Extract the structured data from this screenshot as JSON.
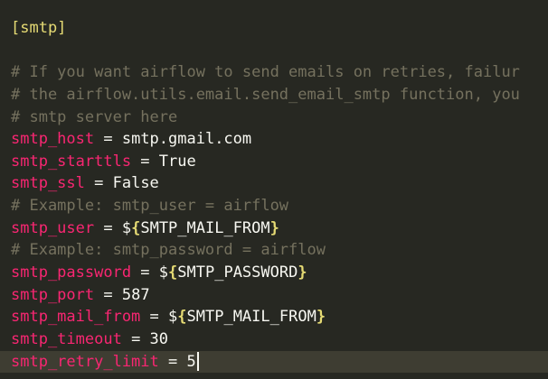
{
  "section_header": "[smtp]",
  "comments": {
    "c1": "# If you want airflow to send emails on retries, failur",
    "c2": "# the airflow.utils.email.send_email_smtp function, you",
    "c3": "# smtp server here",
    "c4": "# Example: smtp_user = airflow",
    "c5": "# Example: smtp_password = airflow"
  },
  "operator": " = ",
  "entries": {
    "smtp_host": {
      "key": "smtp_host",
      "value": "smtp.gmail.com"
    },
    "smtp_starttls": {
      "key": "smtp_starttls",
      "value": "True"
    },
    "smtp_ssl": {
      "key": "smtp_ssl",
      "value": "False"
    },
    "smtp_user": {
      "key": "smtp_user",
      "prefix": "$",
      "open": "{",
      "var": "SMTP_MAIL_FROM",
      "close": "}"
    },
    "smtp_password": {
      "key": "smtp_password",
      "prefix": "$",
      "open": "{",
      "var": "SMTP_PASSWORD",
      "close": "}"
    },
    "smtp_port": {
      "key": "smtp_port",
      "value": "587"
    },
    "smtp_mail_from": {
      "key": "smtp_mail_from",
      "prefix": "$",
      "open": "{",
      "var": "SMTP_MAIL_FROM",
      "close": "}"
    },
    "smtp_timeout": {
      "key": "smtp_timeout",
      "value": "30"
    },
    "smtp_retry_limit": {
      "key": "smtp_retry_limit",
      "value": "5"
    }
  },
  "colors": {
    "background": "#272822",
    "current_line": "#3e3d32",
    "key": "#f92672",
    "comment": "#75715e",
    "section": "#e6db74",
    "text": "#f8f8f2"
  }
}
